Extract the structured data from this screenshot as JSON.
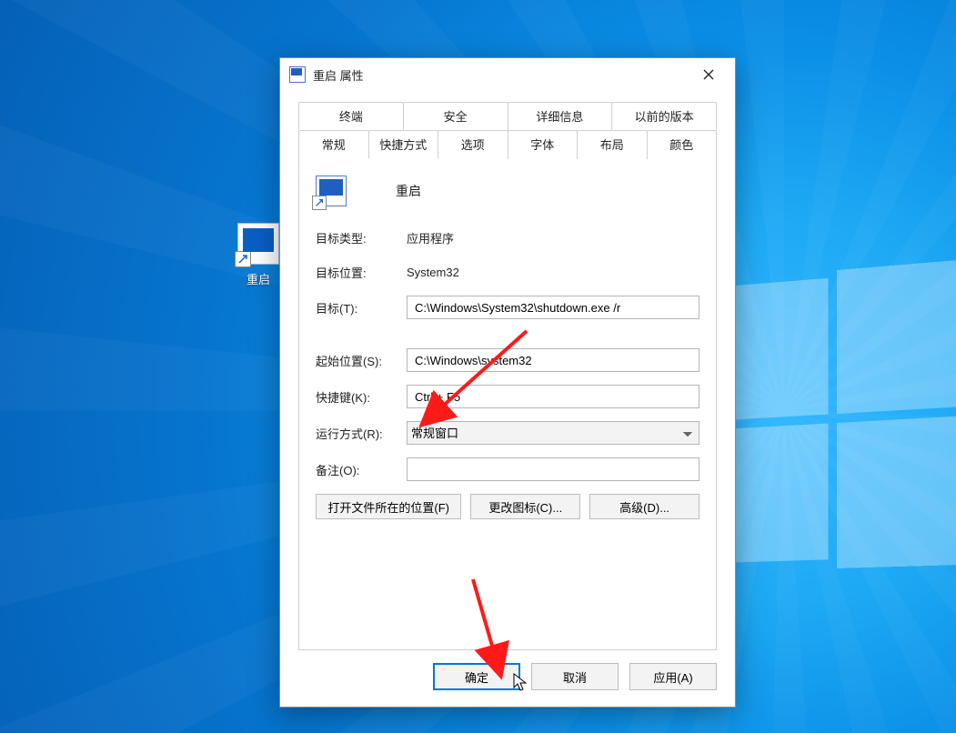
{
  "desktop": {
    "shortcut_label": "重启"
  },
  "dialog": {
    "title": "重启 属性",
    "tabs_row1": [
      "终端",
      "安全",
      "详细信息",
      "以前的版本"
    ],
    "tabs_row2": [
      "常规",
      "快捷方式",
      "选项",
      "字体",
      "布局",
      "颜色"
    ],
    "active_tab": "快捷方式",
    "shortcut_name": "重启",
    "labels": {
      "target_type": "目标类型:",
      "target_location": "目标位置:",
      "target": "目标(T):",
      "start_in": "起始位置(S):",
      "hotkey": "快捷键(K):",
      "run": "运行方式(R):",
      "comment": "备注(O):"
    },
    "values": {
      "target_type": "应用程序",
      "target_location": "System32",
      "target": "C:\\Windows\\System32\\shutdown.exe /r",
      "start_in": "C:\\Windows\\system32",
      "hotkey": "Ctrl + F5",
      "run": "常规窗口",
      "comment": ""
    },
    "buttons": {
      "open_location": "打开文件所在的位置(F)",
      "change_icon": "更改图标(C)...",
      "advanced": "高级(D)..."
    },
    "footer": {
      "ok": "确定",
      "cancel": "取消",
      "apply": "应用(A)"
    }
  }
}
